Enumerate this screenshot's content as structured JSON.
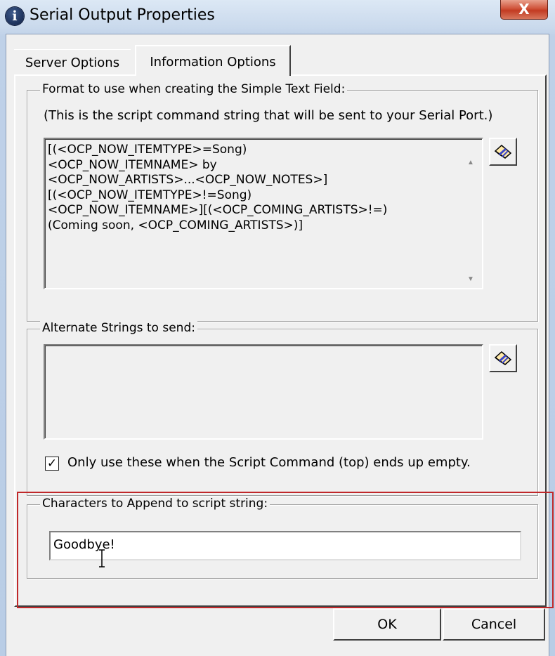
{
  "window": {
    "title": "Serial Output Properties",
    "close_glyph": "X",
    "icon": "info-icon"
  },
  "tabs": [
    {
      "label": "Server Options",
      "active": false
    },
    {
      "label": "Information Options",
      "active": true
    }
  ],
  "format_group": {
    "label": "Format to use when creating the Simple Text Field:",
    "hint": "(This is the script command string that will be sent to your Serial Port.)",
    "script_text": "[(<OCP_NOW_ITEMTYPE>=Song)\n<OCP_NOW_ITEMNAME> by\n<OCP_NOW_ARTISTS>...<OCP_NOW_NOTES>]\n[(<OCP_NOW_ITEMTYPE>!=Song)\n<OCP_NOW_ITEMNAME>][(<OCP_COMING_ARTISTS>!=)\n(Coming soon, <OCP_COMING_ARTISTS>)]",
    "tool_icon": "eraser-icon"
  },
  "alternate_group": {
    "label": "Alternate Strings to send:",
    "value": "",
    "checkbox_checked": true,
    "checkbox_mark": "✓",
    "checkbox_label": "Only use these when the Script Command (top) ends up empty."
  },
  "append_group": {
    "label": "Characters to Append to script string:",
    "value": "Goodbye!"
  },
  "buttons": {
    "ok": "OK",
    "cancel": "Cancel"
  },
  "colors": {
    "highlight": "#c0282a",
    "close_button": "#c23b22"
  }
}
